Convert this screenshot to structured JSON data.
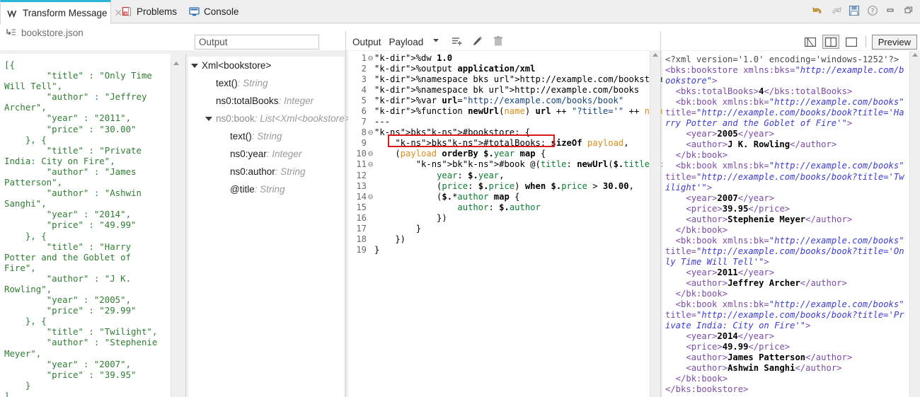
{
  "window": {
    "buttons": [
      {
        "name": "undo-icon",
        "title": "Undo"
      },
      {
        "name": "redo-icon",
        "title": "Redo"
      },
      {
        "name": "save-icon",
        "title": "Save"
      },
      {
        "name": "help-icon",
        "title": "Help"
      },
      {
        "name": "minimize-icon",
        "title": "Minimize"
      },
      {
        "name": "restore-icon",
        "title": "Restore"
      }
    ]
  },
  "tabs": [
    {
      "label": "Transform Message",
      "icon": "transform-icon",
      "active": true,
      "closable": true
    },
    {
      "label": "Problems",
      "icon": "problems-icon",
      "active": false,
      "closable": false
    },
    {
      "label": "Console",
      "icon": "console-icon",
      "active": false,
      "closable": false
    }
  ],
  "input_panel": {
    "file_label": "bookstore.json",
    "file_icon": "input-payload-icon",
    "json_text": "[{\n        \"title\" : \"Only Time Will Tell\",\n        \"author\" : \"Jeffrey Archer\",\n        \"year\" : \"2011\",\n        \"price\" : \"30.00\"\n    }, {\n        \"title\" : \"Private India: City on Fire\",\n        \"author\" : \"James Patterson\",\n        \"author\" : \"Ashwin Sanghi\",\n        \"year\" : \"2014\",\n        \"price\" : \"49.99\"\n    }, {\n        \"title\" : \"Harry Potter and the Goblet of Fire\",\n        \"author\" : \"J K. Rowling\",\n        \"year\" : \"2005\",\n        \"price\" : \"29.99\"\n    }, {\n        \"title\" : \"Twilight\",\n        \"author\" : \"Stephenie Meyer\",\n        \"year\" : \"2007\",\n        \"price\" : \"39.95\"\n    }\n]"
  },
  "tree_panel": {
    "search_value": "Output",
    "search_placeholder": "Output",
    "nodes": [
      {
        "label": "Xml<bookstore>",
        "type": "",
        "indent": 0,
        "twisty": "expanded",
        "dim": false
      },
      {
        "label": "text()",
        "type": "String",
        "indent": 1,
        "twisty": "none",
        "dim": false
      },
      {
        "label": "ns0:totalBooks",
        "type": "Integer",
        "indent": 1,
        "twisty": "none",
        "dim": false
      },
      {
        "label": "ns0:book",
        "type": "List<Xml<bookstore>>",
        "indent": 1,
        "twisty": "expanded",
        "dim": true
      },
      {
        "label": "text()",
        "type": "String",
        "indent": 2,
        "twisty": "none",
        "dim": false
      },
      {
        "label": "ns0:year",
        "type": "Integer",
        "indent": 2,
        "twisty": "none",
        "dim": false
      },
      {
        "label": "ns0:author",
        "type": "String",
        "indent": 2,
        "twisty": "none",
        "dim": false
      },
      {
        "label": "@title",
        "type": "String",
        "indent": 2,
        "twisty": "none",
        "dim": false
      }
    ]
  },
  "editor_toolbar": {
    "output_label": "Output",
    "payload_label": "Payload",
    "dropdown_icon": "chevron-down-icon",
    "add_icon": "add-list-icon",
    "edit_icon": "pencil-icon",
    "delete_icon": "trash-icon"
  },
  "right_toolbar": {
    "layout_buttons": [
      {
        "name": "layout-single-icon",
        "selected": false
      },
      {
        "name": "layout-split-icon",
        "selected": true
      },
      {
        "name": "layout-wide-icon",
        "selected": false
      }
    ],
    "preview_label": "Preview"
  },
  "code_editor": {
    "line_count": 19,
    "highlight": {
      "line": 9,
      "text": "bks#totalBooks: sizeOf payload,"
    },
    "lines": [
      {
        "n": 1,
        "fold": "minus",
        "text": "%dw 1.0"
      },
      {
        "n": 2,
        "fold": "none",
        "text": "%output application/xml"
      },
      {
        "n": 3,
        "fold": "none",
        "text": "%namespace bks http://example.com/bookstore"
      },
      {
        "n": 4,
        "fold": "none",
        "text": "%namespace bk http://example.com/books"
      },
      {
        "n": 5,
        "fold": "none",
        "text": "%var url=\"http://example.com/books/book\""
      },
      {
        "n": 6,
        "fold": "none",
        "text": "%function newUrl(name) url ++ \"?title='\" ++ name ++ \"'\""
      },
      {
        "n": 7,
        "fold": "none",
        "text": "---"
      },
      {
        "n": 8,
        "fold": "minus",
        "text": "bks#bookstore: {"
      },
      {
        "n": 9,
        "fold": "none",
        "text": "    bks#totalBooks: sizeOf payload,"
      },
      {
        "n": 10,
        "fold": "minus",
        "text": "    (payload orderBy $.year map {"
      },
      {
        "n": 11,
        "fold": "minus",
        "text": "        bk#book @(title: newUrl($.title)): {"
      },
      {
        "n": 12,
        "fold": "none",
        "text": "            year: $.year,"
      },
      {
        "n": 13,
        "fold": "none",
        "text": "            (price: $.price) when $.price > 30.00,"
      },
      {
        "n": 14,
        "fold": "minus",
        "text": "            ($.*author map {"
      },
      {
        "n": 15,
        "fold": "none",
        "text": "                author: $.author"
      },
      {
        "n": 16,
        "fold": "none",
        "text": "            })"
      },
      {
        "n": 17,
        "fold": "none",
        "text": "        }"
      },
      {
        "n": 18,
        "fold": "none",
        "text": "    })"
      },
      {
        "n": 19,
        "fold": "none",
        "text": "}"
      }
    ]
  },
  "xml_output": {
    "declaration": "<?xml version='1.0' encoding='windows-1252'?>",
    "root_open": "<bks:bookstore xmlns:bks=\"http://example.com/bookstore\">",
    "total_books": "4",
    "books": [
      {
        "title": "Harry Potter and the Goblet of Fire",
        "title_url": "http://example.com/books/book?title='Harry Potter and the Goblet of Fire'",
        "year": "2005",
        "price": null,
        "authors": [
          "J K. Rowling"
        ]
      },
      {
        "title": "Twilight",
        "title_url": "http://example.com/books/book?title='Twilight'",
        "year": "2007",
        "price": "39.95",
        "authors": [
          "Stephenie Meyer"
        ]
      },
      {
        "title": "Only Time Will Tell",
        "title_url": "http://example.com/books/book?title='Only Time Will Tell'",
        "year": "2011",
        "price": null,
        "authors": [
          "Jeffrey Archer"
        ]
      },
      {
        "title": "Private India: City on Fire",
        "title_url": "http://example.com/books/book?title='Private India: City on Fire'",
        "year": "2014",
        "price": "49.99",
        "authors": [
          "James Patterson",
          "Ashwin Sanghi"
        ]
      }
    ],
    "books_ns": "http://example.com/books",
    "root_close": "</bks:bookstore>"
  },
  "colors": {
    "active_tab_accent": "#29b6d8",
    "highlight_box": "#d81c1c",
    "json_text": "#2e7d32",
    "xml_tag": "#7b4bab",
    "xml_value": "#3b3bd6"
  }
}
